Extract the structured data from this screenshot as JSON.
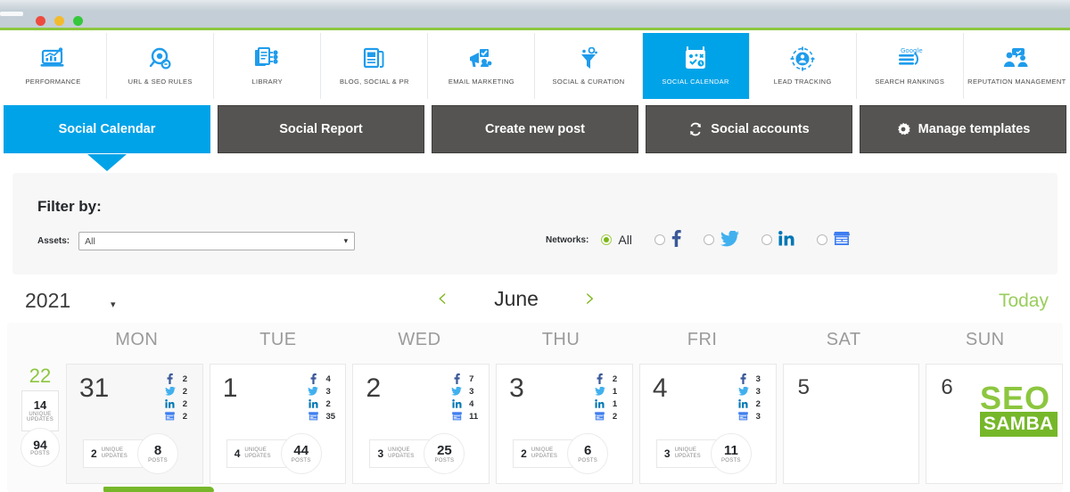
{
  "browser": {
    "dots": [
      "red",
      "yellow",
      "green"
    ]
  },
  "topnav": {
    "items": [
      {
        "label": "PERFORMANCE",
        "icon": "chart-laptop-icon",
        "active": false
      },
      {
        "label": "URL & SEO RULES",
        "icon": "magnifier-link-icon",
        "active": false
      },
      {
        "label": "LIBRARY",
        "icon": "documents-network-icon",
        "active": false
      },
      {
        "label": "BLOG, SOCIAL & PR",
        "icon": "newspaper-icon",
        "active": false
      },
      {
        "label": "EMAIL MARKETING",
        "icon": "megaphone-icon",
        "active": false
      },
      {
        "label": "SOCIAL & CURATION",
        "icon": "funnel-icon",
        "active": false
      },
      {
        "label": "SOCIAL CALENDAR",
        "icon": "calendar-icon",
        "active": true
      },
      {
        "label": "LEAD TRACKING",
        "icon": "target-people-icon",
        "active": false
      },
      {
        "label": "SEARCH RANKINGS",
        "icon": "google-ranking-icon",
        "active": false
      },
      {
        "label": "REPUTATION MANAGEMENT",
        "icon": "people-chat-icon",
        "active": false
      }
    ]
  },
  "actions": [
    {
      "label": "Social Calendar",
      "icon": null,
      "active": true
    },
    {
      "label": "Social Report",
      "icon": null,
      "active": false
    },
    {
      "label": "Create new post",
      "icon": null,
      "active": false
    },
    {
      "label": "Social accounts",
      "icon": "refresh-icon",
      "active": false
    },
    {
      "label": "Manage templates",
      "icon": "gear-icon",
      "active": false
    }
  ],
  "filter": {
    "title": "Filter by:",
    "assets_label": "Assets:",
    "assets_value": "All",
    "assets_options": [
      "All"
    ],
    "networks_label": "Networks:",
    "networks": [
      {
        "name": "All",
        "icon": "text",
        "text": "All",
        "selected": true
      },
      {
        "name": "facebook",
        "icon": "facebook-icon",
        "text": "",
        "selected": false
      },
      {
        "name": "twitter",
        "icon": "twitter-icon",
        "text": "",
        "selected": false
      },
      {
        "name": "linkedin",
        "icon": "linkedin-icon",
        "text": "",
        "selected": false
      },
      {
        "name": "gmb",
        "icon": "storefront-icon",
        "text": "",
        "selected": false
      }
    ]
  },
  "monthbar": {
    "year": "2021",
    "month": "June",
    "prev": "‹",
    "next": "›",
    "today": "Today"
  },
  "calendar": {
    "day_headers": [
      "MON",
      "TUE",
      "WED",
      "THU",
      "FRI",
      "SAT",
      "SUN"
    ],
    "week": {
      "number": "22",
      "unique_updates": "14",
      "unique_updates_label": "Unique updates",
      "posts": "94",
      "posts_label": "Posts"
    },
    "labels": {
      "unique": "Unique",
      "updates": "Updates",
      "posts": "Posts"
    },
    "days": [
      {
        "num": "31",
        "past": true,
        "small": false,
        "counts": [
          {
            "network": "facebook",
            "value": "2"
          },
          {
            "network": "twitter",
            "value": "2"
          },
          {
            "network": "linkedin",
            "value": "2"
          },
          {
            "network": "gmb",
            "value": "2"
          }
        ],
        "unique_updates": "2",
        "posts": "8",
        "has_stats": true,
        "logo": false
      },
      {
        "num": "1",
        "past": false,
        "small": false,
        "counts": [
          {
            "network": "facebook",
            "value": "4"
          },
          {
            "network": "twitter",
            "value": "3"
          },
          {
            "network": "linkedin",
            "value": "2"
          },
          {
            "network": "gmb",
            "value": "35"
          }
        ],
        "unique_updates": "4",
        "posts": "44",
        "has_stats": true,
        "logo": false
      },
      {
        "num": "2",
        "past": false,
        "small": false,
        "counts": [
          {
            "network": "facebook",
            "value": "7"
          },
          {
            "network": "twitter",
            "value": "3"
          },
          {
            "network": "linkedin",
            "value": "4"
          },
          {
            "network": "gmb",
            "value": "11"
          }
        ],
        "unique_updates": "3",
        "posts": "25",
        "has_stats": true,
        "logo": false
      },
      {
        "num": "3",
        "past": false,
        "small": false,
        "counts": [
          {
            "network": "facebook",
            "value": "2"
          },
          {
            "network": "twitter",
            "value": "1"
          },
          {
            "network": "linkedin",
            "value": "1"
          },
          {
            "network": "gmb",
            "value": "2"
          }
        ],
        "unique_updates": "2",
        "posts": "6",
        "has_stats": true,
        "logo": false
      },
      {
        "num": "4",
        "past": false,
        "small": false,
        "counts": [
          {
            "network": "facebook",
            "value": "3"
          },
          {
            "network": "twitter",
            "value": "3"
          },
          {
            "network": "linkedin",
            "value": "2"
          },
          {
            "network": "gmb",
            "value": "3"
          }
        ],
        "unique_updates": "3",
        "posts": "11",
        "has_stats": true,
        "logo": false
      },
      {
        "num": "5",
        "past": false,
        "small": true,
        "counts": [],
        "unique_updates": "",
        "posts": "",
        "has_stats": false,
        "logo": false
      },
      {
        "num": "6",
        "past": false,
        "small": true,
        "counts": [],
        "unique_updates": "",
        "posts": "",
        "has_stats": false,
        "logo": true
      }
    ]
  },
  "logo": {
    "top": "SEO",
    "bottom": "SAMBA"
  },
  "colors": {
    "accent_blue": "#00a3e8",
    "accent_green": "#8cc63f",
    "dark_button": "#555452",
    "facebook": "#3b5998",
    "twitter": "#41b0ef",
    "linkedin": "#0077b5",
    "gmb": "#3f7ef0"
  }
}
